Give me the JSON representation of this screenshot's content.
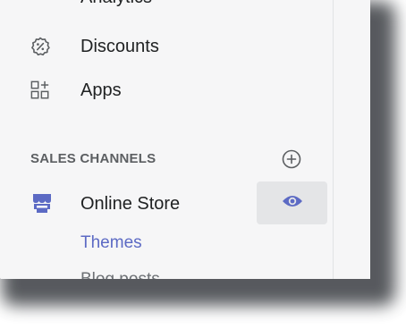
{
  "nav": {
    "items": [
      {
        "label": "Analytics",
        "icon": "analytics-icon"
      },
      {
        "label": "Discounts",
        "icon": "discount-icon"
      },
      {
        "label": "Apps",
        "icon": "apps-icon"
      }
    ]
  },
  "sales_channels": {
    "header": "SALES CHANNELS",
    "add_icon": "plus-circle-icon",
    "channels": [
      {
        "label": "Online Store",
        "icon": "online-store-icon",
        "action_icon": "eye-icon"
      }
    ],
    "sub_items": [
      {
        "label": "Themes"
      },
      {
        "label": "Blog posts"
      }
    ]
  },
  "colors": {
    "accent": "#5c6ac4",
    "text": "#202223",
    "muted": "#5c5f62",
    "nav_bg": "#f6f6f7",
    "active_bg": "#e4e5e7"
  }
}
